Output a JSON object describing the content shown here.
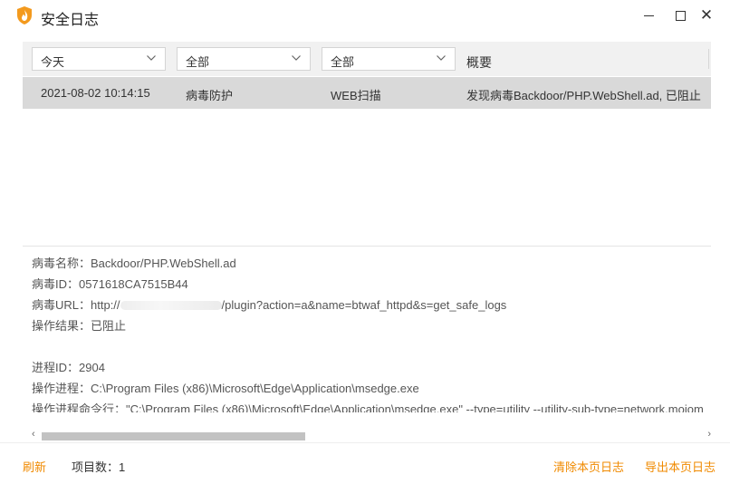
{
  "window": {
    "title": "安全日志",
    "icon": "shield-flame-icon",
    "controls": {
      "minimize": "minimize-icon",
      "maximize": "maximize-icon",
      "close": "close-icon"
    }
  },
  "filters": {
    "date": "今天",
    "type": "全部",
    "module": "全部",
    "summary_header": "概要"
  },
  "log_rows": [
    {
      "time": "2021-08-02 10:14:15",
      "type": "病毒防护",
      "module": "WEB扫描",
      "summary": "发现病毒Backdoor/PHP.WebShell.ad, 已阻止"
    }
  ],
  "detail": {
    "virus_name": "病毒名称：Backdoor/PHP.WebShell.ad",
    "virus_id": "病毒ID：0571618CA7515B44",
    "virus_url_prefix": "病毒URL：http://",
    "virus_url_suffix": "/plugin?action=a&name=btwaf_httpd&s=get_safe_logs",
    "result": "操作结果：已阻止",
    "process_id": "进程ID：2904",
    "process_path": "操作进程：C:\\Program Files (x86)\\Microsoft\\Edge\\Application\\msedge.exe",
    "process_cmdline": "操作进程命令行：\"C:\\Program Files (x86)\\Microsoft\\Edge\\Application\\msedge.exe\" --type=utility --utility-sub-type=network.mojom"
  },
  "scrollbar": {
    "left_arrow": "‹",
    "right_arrow": "›",
    "position": 0.0
  },
  "footer": {
    "refresh": "刷新",
    "item_count": "项目数：1",
    "clear_page": "清除本页日志",
    "export_page": "导出本页日志"
  },
  "colors": {
    "accent": "#f08a00",
    "selected_row": "#d9d9d9",
    "filter_bg": "#f1f1f1"
  }
}
